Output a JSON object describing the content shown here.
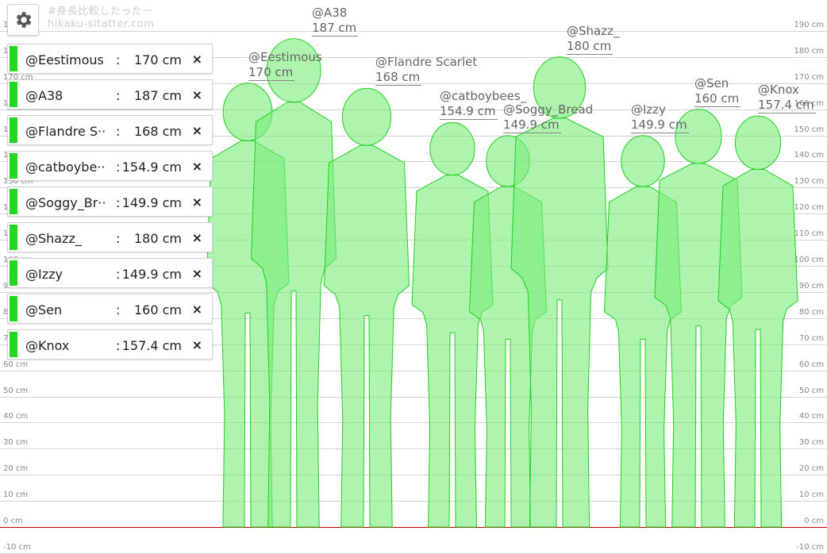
{
  "watermark": {
    "line1": "#身長比較したったー",
    "line2": "hikaku-sitatter.com"
  },
  "settings": {
    "icon": "gear-icon"
  },
  "axis": {
    "unit": "cm",
    "ticks": [
      {
        "v": 190,
        "label": "190 cm"
      },
      {
        "v": 180,
        "label": "180 cm"
      },
      {
        "v": 170,
        "label": "170 cm"
      },
      {
        "v": 160,
        "label": "160 cm"
      },
      {
        "v": 150,
        "label": "150 cm"
      },
      {
        "v": 140,
        "label": "140 cm"
      },
      {
        "v": 130,
        "label": "130 cm"
      },
      {
        "v": 120,
        "label": "120 cm"
      },
      {
        "v": 110,
        "label": "110 cm"
      },
      {
        "v": 100,
        "label": "100 cm"
      },
      {
        "v": 90,
        "label": "90 cm"
      },
      {
        "v": 80,
        "label": "80 cm"
      },
      {
        "v": 70,
        "label": "70 cm"
      },
      {
        "v": 60,
        "label": "60 cm"
      },
      {
        "v": 50,
        "label": "50 cm"
      },
      {
        "v": 40,
        "label": "40 cm"
      },
      {
        "v": 30,
        "label": "30 cm"
      },
      {
        "v": 20,
        "label": "20 cm"
      },
      {
        "v": 10,
        "label": "10 cm"
      },
      {
        "v": 0,
        "label": "0 cm"
      },
      {
        "v": -10,
        "label": "-10 cm"
      }
    ]
  },
  "colors": {
    "figure_fill": "#7dee7d",
    "figure_stroke": "#22d022",
    "swatch": "#1fd81f",
    "baseline": "#c00000"
  },
  "people": [
    {
      "name": "@Eestimous",
      "list_name": "@Eestimous",
      "height": 170,
      "height_label": "170 cm"
    },
    {
      "name": "@A38",
      "list_name": "@A38",
      "height": 187,
      "height_label": "187 cm"
    },
    {
      "name": "@Flandre Scarlet",
      "list_name": "@Flandre S···",
      "height": 168,
      "height_label": "168 cm"
    },
    {
      "name": "@catboybees_",
      "list_name": "@catboybe···",
      "height": 154.9,
      "height_label": "154.9 cm"
    },
    {
      "name": "@Soggy_Bread",
      "list_name": "@Soggy_Br···",
      "height": 149.9,
      "height_label": "149.9 cm"
    },
    {
      "name": "@Shazz_",
      "list_name": "@Shazz_",
      "height": 180,
      "height_label": "180 cm"
    },
    {
      "name": "@Izzy",
      "list_name": "@Izzy",
      "height": 149.9,
      "height_label": "149.9 cm"
    },
    {
      "name": "@Sen",
      "list_name": "@Sen",
      "height": 160,
      "height_label": "160 cm"
    },
    {
      "name": "@Knox",
      "list_name": "@Knox",
      "height": 157.4,
      "height_label": "157.4 cm"
    }
  ],
  "list": {
    "colon": ":",
    "remove_symbol": "×"
  }
}
